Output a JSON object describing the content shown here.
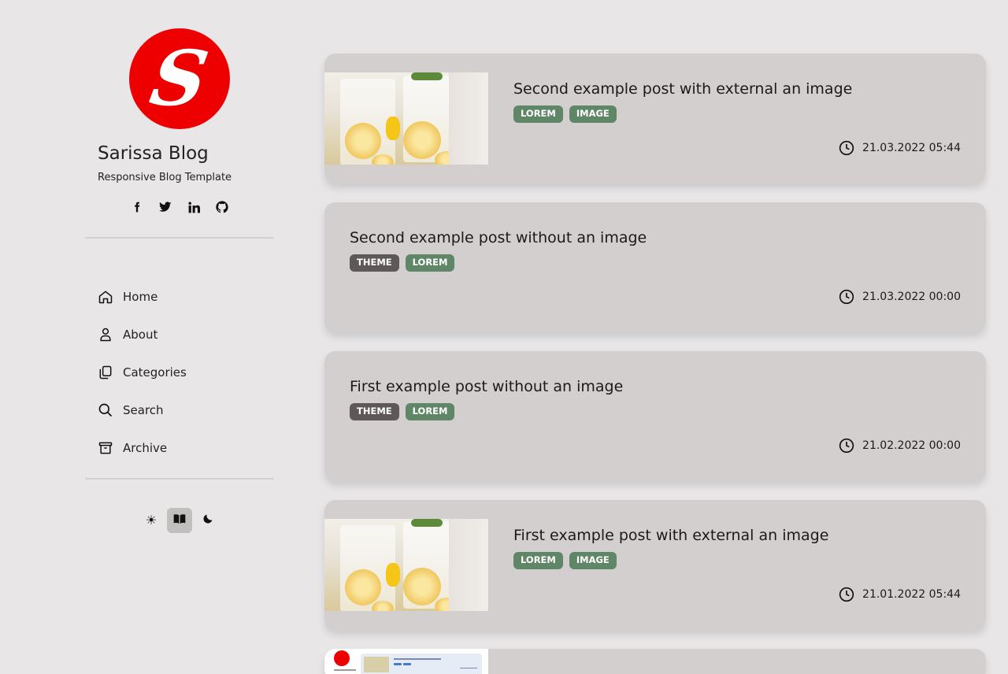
{
  "site": {
    "logo_letter": "S",
    "title": "Sarissa Blog",
    "subtitle": "Responsive Blog Template"
  },
  "social": [
    {
      "name": "facebook-icon",
      "glyph": "f"
    },
    {
      "name": "twitter-icon",
      "glyph": "t"
    },
    {
      "name": "linkedin-icon",
      "glyph": "in"
    },
    {
      "name": "github-icon",
      "glyph": "gh"
    }
  ],
  "nav": {
    "home": "Home",
    "about": "About",
    "categories": "Categories",
    "search": "Search",
    "archive": "Archive"
  },
  "theme": {
    "light_glyph": "☀",
    "dark_glyph": "☾",
    "active": "book"
  },
  "posts": [
    {
      "title": "Second example post with external an image",
      "tags": [
        "LOREM",
        "IMAGE"
      ],
      "date": "21.03.2022 05:44",
      "has_image": true
    },
    {
      "title": "Second example post without an image",
      "tags": [
        "THEME",
        "LOREM"
      ],
      "date": "21.03.2022 00:00",
      "has_image": false
    },
    {
      "title": "First example post without an image",
      "tags": [
        "THEME",
        "LOREM"
      ],
      "date": "21.02.2022 00:00",
      "has_image": false
    },
    {
      "title": "First example post with external an image",
      "tags": [
        "LOREM",
        "IMAGE"
      ],
      "date": "21.01.2022 05:44",
      "has_image": true
    }
  ],
  "colors": {
    "background": "#e8e6e7",
    "card": "#d3cfce",
    "tag_green": "#5f8767",
    "tag_dark": "#5f5858",
    "logo_red": "#ee0000"
  }
}
